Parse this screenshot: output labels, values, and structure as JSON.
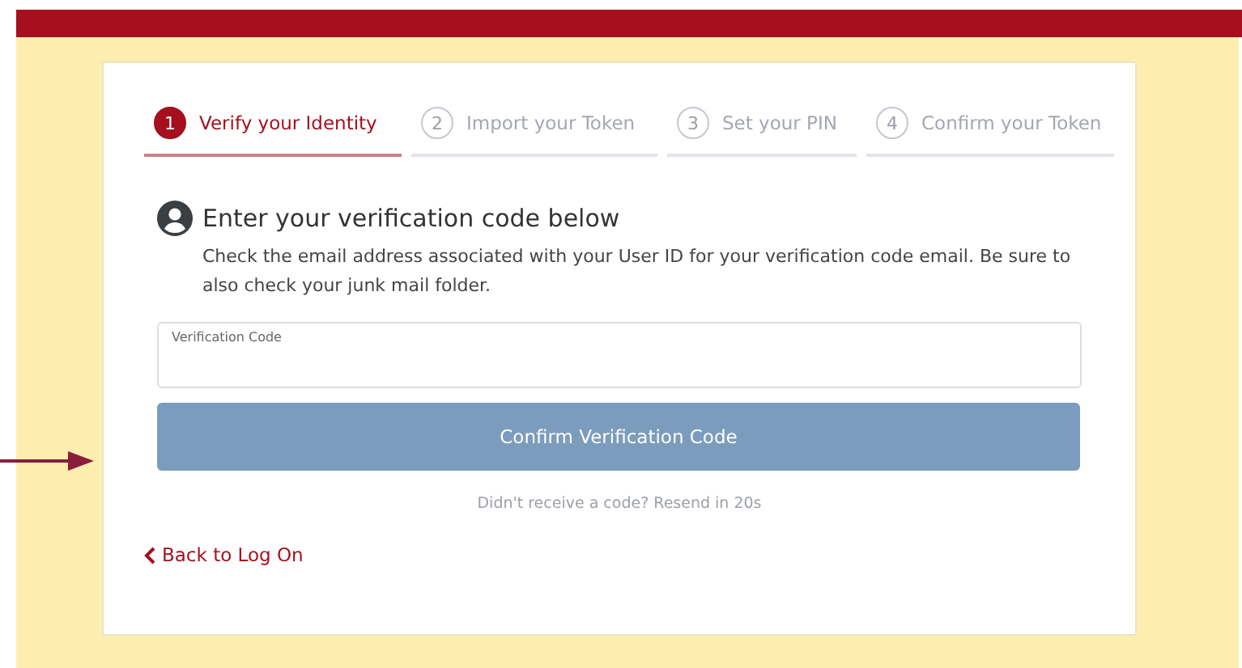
{
  "steps": [
    {
      "number": "1",
      "label": "Verify your Identity",
      "selected": true
    },
    {
      "number": "2",
      "label": "Import your Token",
      "selected": false
    },
    {
      "number": "3",
      "label": "Set your PIN",
      "selected": false
    },
    {
      "number": "4",
      "label": "Confirm your Token",
      "selected": false
    }
  ],
  "heading": "Enter your verification code below",
  "description": "Check the email address associated with your User ID for your verification code email. Be sure to also check your junk mail folder.",
  "field": {
    "label": "Verification Code"
  },
  "confirm_button": "Confirm Verification Code",
  "resend_note": "Didn't receive a code? Resend in 20s",
  "back_link": "Back to Log On"
}
